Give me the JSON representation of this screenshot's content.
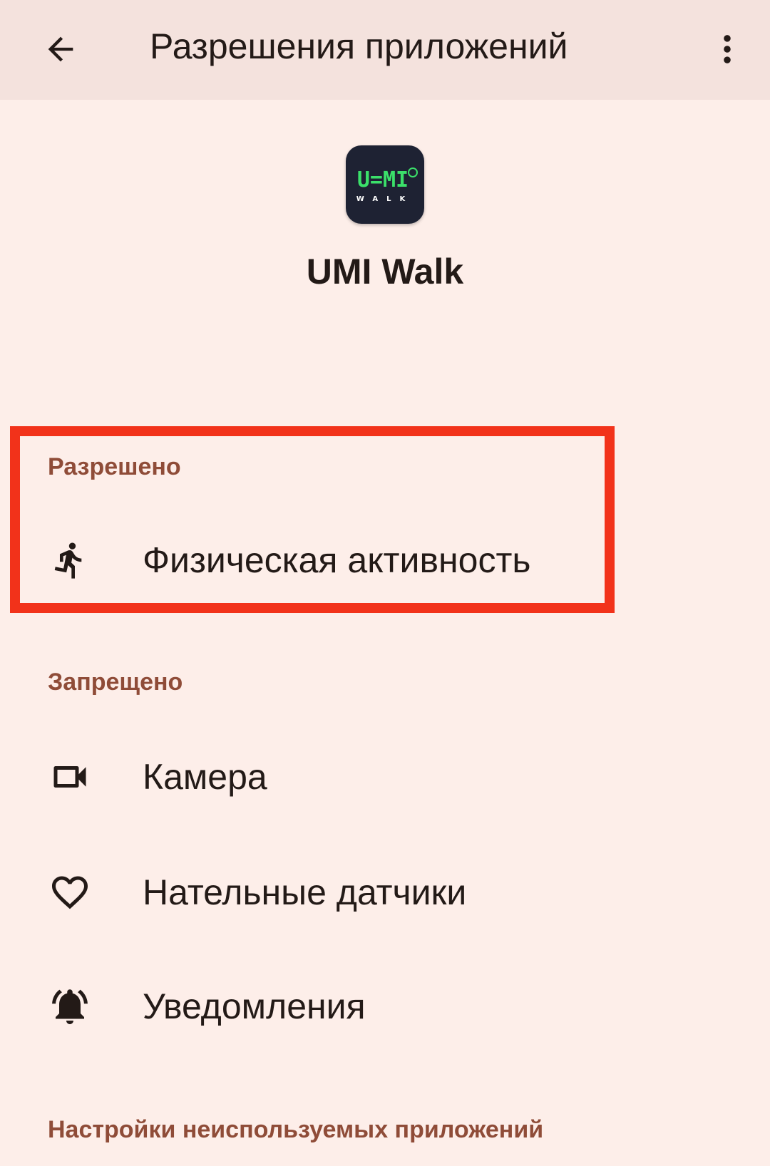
{
  "appbar": {
    "title": "Разрешения приложений",
    "back_icon": "arrow-back-icon",
    "more_icon": "more-vert-icon"
  },
  "app": {
    "name": "UMI Walk",
    "icon": "umi-walk-app-icon",
    "icon_text_top": "U=MI",
    "icon_text_bottom": "WALK"
  },
  "sections": {
    "allowed": {
      "header": "Разрешено",
      "items": [
        {
          "label": "Физическая активность",
          "icon": "directions-run-icon"
        }
      ]
    },
    "denied": {
      "header": "Запрещено",
      "items": [
        {
          "label": "Камера",
          "icon": "videocam-icon"
        },
        {
          "label": "Нательные датчики",
          "icon": "heart-icon"
        },
        {
          "label": "Уведомления",
          "icon": "notifications-active-icon"
        }
      ]
    },
    "unused": {
      "header": "Настройки неиспользуемых приложений"
    }
  },
  "colors": {
    "background": "#fdeee9",
    "appbar": "#f4e2dd",
    "section_header": "#8f4c38",
    "highlight": "#f2321a",
    "text": "#231a17"
  }
}
